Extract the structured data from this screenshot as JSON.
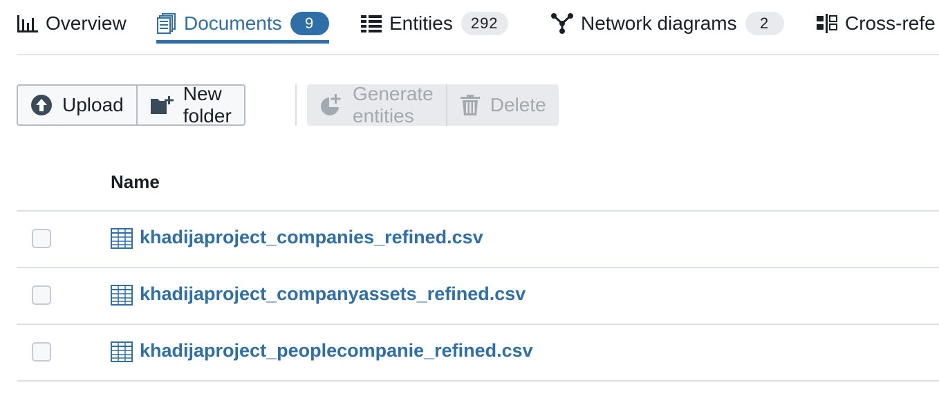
{
  "tabs": [
    {
      "label": "Overview",
      "icon": "bar-chart-icon",
      "count": null
    },
    {
      "label": "Documents",
      "icon": "documents-icon",
      "count": "9",
      "active": true
    },
    {
      "label": "Entities",
      "icon": "list-icon",
      "count": "292"
    },
    {
      "label": "Network diagrams",
      "icon": "network-icon",
      "count": "2"
    },
    {
      "label": "Cross-refe",
      "icon": "cross-reference-icon",
      "count": null
    }
  ],
  "toolbar": {
    "upload_label": "Upload",
    "new_folder_label": "New folder",
    "generate_entities_label": "Generate entities",
    "delete_label": "Delete"
  },
  "table": {
    "header_name": "Name",
    "rows": [
      {
        "name": "khadijaproject_companies_refined.csv",
        "icon": "table-file-icon"
      },
      {
        "name": "khadijaproject_companyassets_refined.csv",
        "icon": "table-file-icon"
      },
      {
        "name": "khadijaproject_peoplecompanie_refined.csv",
        "icon": "table-file-icon"
      }
    ]
  },
  "colors": {
    "accent": "#2f6fa8",
    "text": "#182026",
    "disabled_text": "#a2a9b0",
    "badge_bg": "#e8eaed"
  }
}
